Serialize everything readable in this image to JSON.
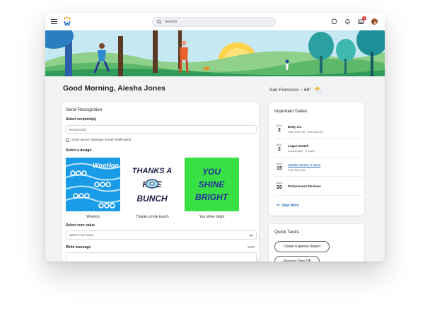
{
  "search": {
    "placeholder": "Search"
  },
  "notifications": {
    "badge": "1"
  },
  "greeting": "Good Morning, Aiesha Jones",
  "weather": {
    "text": "San Francisco ~ 68°"
  },
  "recognition": {
    "title": "Send Recognition",
    "recipients_label": "Select recipient(s)",
    "recipients_placeholder": "Recipient(s)",
    "email_checkbox_label": "Send Issuer Manager Email Notification",
    "design_label": "Select a design",
    "designs": [
      {
        "name": "Woohoo",
        "art_text": "WooHoo",
        "bg": "#1a9be8",
        "fg": "#ffffff"
      },
      {
        "name": "Thanks a hole bunch",
        "art_lines": [
          "THANKS A",
          "H  LE",
          "BUNCH"
        ],
        "bg": "#ffffff",
        "fg": "#1e2247"
      },
      {
        "name": "You shine bright",
        "art_lines": [
          "YOU",
          "SHINE",
          "BRIGHT"
        ],
        "bg": "#38e044",
        "fg": "#2a2f9a"
      }
    ],
    "core_value_label": "Select core value",
    "core_value_placeholder": "Select core value",
    "message_label": "Write message",
    "message_limit": "2500"
  },
  "important_dates": {
    "title": "Important Dates",
    "items": [
      {
        "month": "AUG",
        "day": "2",
        "name": "Betty Liu",
        "sub": "Paid Time Off · until Aug 4th",
        "link": false
      },
      {
        "month": "AUG",
        "day": "2",
        "name": "Logan McNeil",
        "sub": "Anniversary · 4 years",
        "link": false
      },
      {
        "month": "AUG",
        "day": "15",
        "name": "Aiesha Jones, 2 more",
        "sub": "Paid Time Off",
        "link": true
      },
      {
        "month": "AUG",
        "day": "20",
        "name": "Performance Reviews",
        "sub": "",
        "link": false
      }
    ],
    "view_more": "View More"
  },
  "quick_tasks": {
    "title": "Quick Tasks",
    "tasks": [
      "Create Expense Report",
      "Request Time Off"
    ]
  },
  "colors": {
    "accent": "#1f6fbf",
    "badge": "#e23b3b",
    "hero_sky": "#bfe6f0"
  }
}
